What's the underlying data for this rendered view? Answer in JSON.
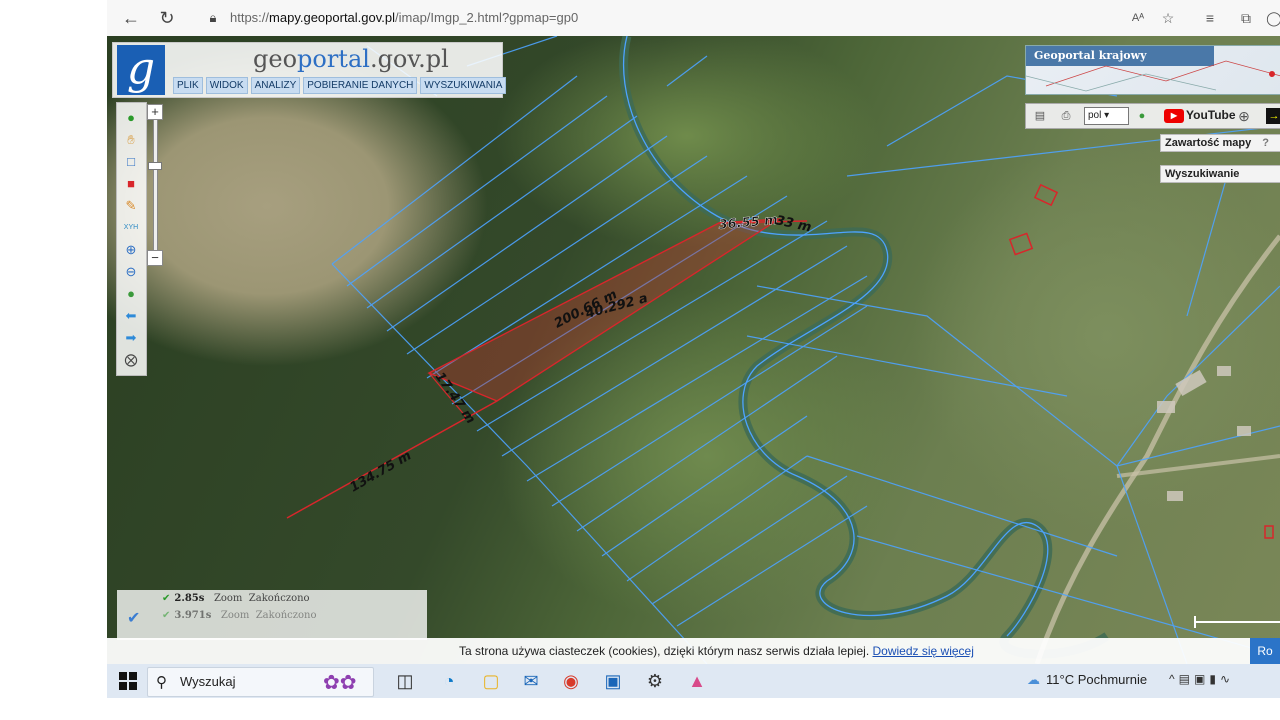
{
  "browser": {
    "url_prefix": "https://",
    "url_host": "mapy.geoportal.gov.pl",
    "url_path": "/imap/Imgp_2.html?gpmap=gp0",
    "reader_icon": "Aᴬ",
    "icons": [
      "back-arrow-icon",
      "refresh-icon",
      "lock-icon",
      "reader-mode-icon",
      "favorite-star-icon",
      "favorites-list-icon",
      "collections-icon",
      "profile-icon"
    ]
  },
  "geoportal": {
    "logo_letter": "g",
    "site_name_part1": "geo",
    "site_name_part2": "portal",
    "site_name_part3": ".gov.pl",
    "menu": [
      "PLIK",
      "WIDOK",
      "ANALIZY",
      "POBIERANIE DANYCH",
      "WYSZUKIWANIA"
    ],
    "zoom_plus": "+",
    "zoom_minus": "−",
    "mini_map_title": "Geoportal krajowy",
    "lang_value": "pol",
    "youtube_label": "YouTube",
    "panels": {
      "content": "Zawartość mapy",
      "content_help": "?",
      "search": "Wyszukiwanie"
    }
  },
  "measurements": {
    "top_segment": "36.55 m",
    "top_segment_overlap": "33 m",
    "long_segment": "200.66 m",
    "area": "40.292 a",
    "short_segment": "17.47 m",
    "lower_segment": "134.75 m"
  },
  "status_log": {
    "rows": [
      {
        "time": "2.85s",
        "action": "Zoom",
        "state": "Zakończono"
      },
      {
        "time": "3.971s",
        "action": "Zoom",
        "state": "Zakończono"
      }
    ]
  },
  "cookie_bar": {
    "text": "Ta strona używa ciasteczek (cookies), dzięki którym nasz serwis działa lepiej.",
    "link": "Dowiedz się więcej",
    "button": "Ro"
  },
  "taskbar": {
    "search_placeholder": "Wyszukaj",
    "weather": "11°C  Pochmurnie",
    "apps": [
      "task-view-icon",
      "edge-icon",
      "file-explorer-icon",
      "mail-icon",
      "chrome-icon",
      "photos-icon",
      "settings-icon",
      "paint-icon"
    ]
  },
  "colors": {
    "measurement_red": "#d8262b",
    "parcel_blue": "#4da3ff",
    "geoportal_blue": "#1a5fb4"
  }
}
